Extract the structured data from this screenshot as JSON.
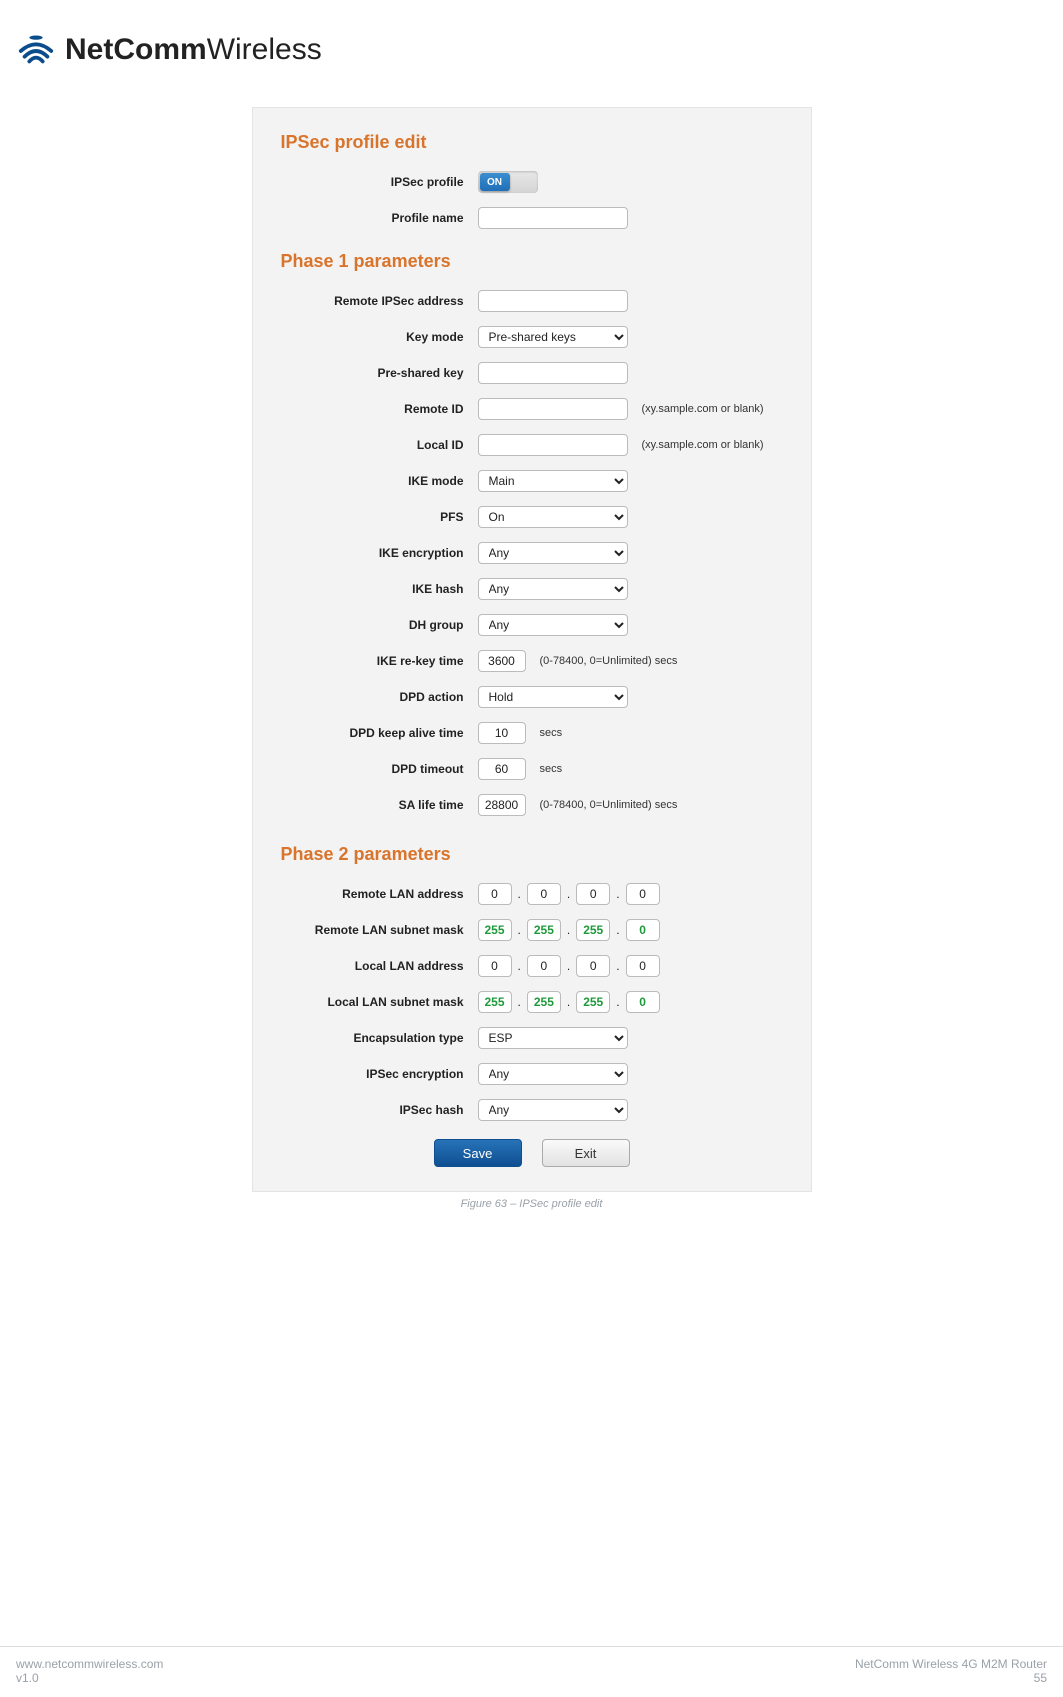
{
  "brand": {
    "bold": "NetComm",
    "light": "Wireless"
  },
  "panel": {
    "title": "IPSec profile edit",
    "ipsec_profile_label": "IPSec profile",
    "toggle_on": "ON",
    "profile_name_label": "Profile name",
    "profile_name_value": ""
  },
  "phase1": {
    "title": "Phase 1 parameters",
    "remote_addr_label": "Remote IPSec address",
    "remote_addr_value": "",
    "key_mode_label": "Key mode",
    "key_mode_value": "Pre-shared keys",
    "psk_label": "Pre-shared key",
    "psk_value": "",
    "remote_id_label": "Remote ID",
    "remote_id_value": "",
    "remote_id_hint": "(xy.sample.com or blank)",
    "local_id_label": "Local ID",
    "local_id_value": "",
    "local_id_hint": "(xy.sample.com or blank)",
    "ike_mode_label": "IKE mode",
    "ike_mode_value": "Main",
    "pfs_label": "PFS",
    "pfs_value": "On",
    "ike_enc_label": "IKE encryption",
    "ike_enc_value": "Any",
    "ike_hash_label": "IKE hash",
    "ike_hash_value": "Any",
    "dh_label": "DH group",
    "dh_value": "Any",
    "ike_rekey_label": "IKE re-key time",
    "ike_rekey_value": "3600",
    "ike_rekey_hint": "(0-78400, 0=Unlimited) secs",
    "dpd_action_label": "DPD action",
    "dpd_action_value": "Hold",
    "dpd_keep_label": "DPD keep alive time",
    "dpd_keep_value": "10",
    "dpd_keep_hint": "secs",
    "dpd_timeout_label": "DPD timeout",
    "dpd_timeout_value": "60",
    "dpd_timeout_hint": "secs",
    "sa_life_label": "SA life time",
    "sa_life_value": "28800",
    "sa_life_hint": "(0-78400, 0=Unlimited) secs"
  },
  "phase2": {
    "title": "Phase 2 parameters",
    "remote_lan_label": "Remote LAN address",
    "remote_lan": [
      "0",
      "0",
      "0",
      "0"
    ],
    "remote_mask_label": "Remote LAN subnet mask",
    "remote_mask": [
      "255",
      "255",
      "255",
      "0"
    ],
    "local_lan_label": "Local LAN address",
    "local_lan": [
      "0",
      "0",
      "0",
      "0"
    ],
    "local_mask_label": "Local LAN subnet mask",
    "local_mask": [
      "255",
      "255",
      "255",
      "0"
    ],
    "encap_label": "Encapsulation type",
    "encap_value": "ESP",
    "ipsec_enc_label": "IPSec encryption",
    "ipsec_enc_value": "Any",
    "ipsec_hash_label": "IPSec hash",
    "ipsec_hash_value": "Any"
  },
  "buttons": {
    "save": "Save",
    "exit": "Exit"
  },
  "caption": "Figure 63 – IPSec profile edit",
  "footer": {
    "url": "www.netcommwireless.com",
    "version": "v1.0",
    "product": "NetComm Wireless 4G M2M Router",
    "pageno": "55"
  }
}
